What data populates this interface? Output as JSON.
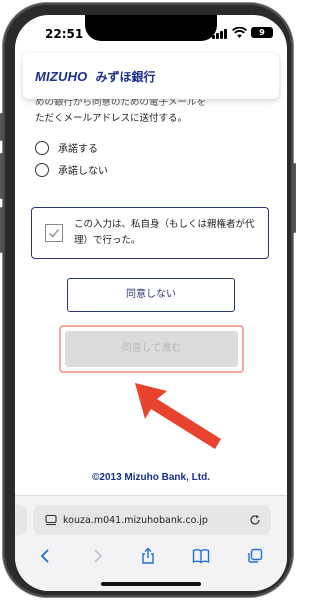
{
  "status_bar": {
    "time": "22:51",
    "battery": "9"
  },
  "header": {
    "logo_en": "MIZUHO",
    "logo_jp": "みずほ銀行"
  },
  "intro": {
    "line1": "めの銀行から同意のための電子メールを",
    "line2": "ただくメールアドレスに送付する。"
  },
  "options": [
    {
      "label": "承諾する"
    },
    {
      "label": "承諾しない"
    }
  ],
  "consent": {
    "text": "この入力は、私自身（もしくは親権者が代理）で行った。"
  },
  "buttons": {
    "disagree": "同意しない",
    "agree": "同意して進む"
  },
  "footer": {
    "copyright": "©2013 Mizuho Bank, Ltd."
  },
  "browser": {
    "address": "kouza.m041.mizuhobank.co.jp"
  },
  "colors": {
    "brand": "#1a2f8c",
    "frame": "#2d3778",
    "arrow": "#e8432e",
    "highlight": "#f2a8a1"
  }
}
